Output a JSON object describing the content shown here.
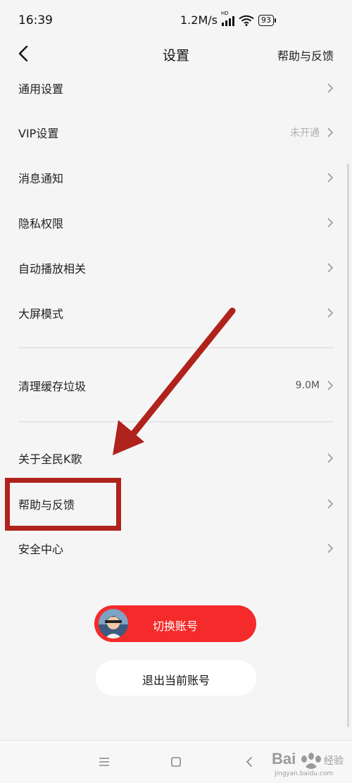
{
  "status_bar": {
    "time": "16:39",
    "net_speed": "1.2M/s",
    "signal_badge": "HD",
    "battery": "93"
  },
  "header": {
    "title": "设置",
    "right_link": "帮助与反馈",
    "back_icon": "back-arrow-icon"
  },
  "settings": {
    "items": [
      {
        "label": "通用设置",
        "value": ""
      },
      {
        "label": "VIP设置",
        "value": "未开通"
      },
      {
        "label": "消息通知",
        "value": ""
      },
      {
        "label": "隐私权限",
        "value": ""
      },
      {
        "label": "自动播放相关",
        "value": ""
      },
      {
        "label": "大屏模式",
        "value": ""
      },
      {
        "label": "清理缓存垃圾",
        "value": "9.0M"
      },
      {
        "label": "关于全民K歌",
        "value": ""
      },
      {
        "label": "帮助与反馈",
        "value": ""
      },
      {
        "label": "安全中心",
        "value": ""
      }
    ]
  },
  "buttons": {
    "switch_account": "切换账号",
    "logout": "退出当前账号"
  },
  "watermark": {
    "brand": "Baidu",
    "site": "jingyan.baidu.com"
  },
  "colors": {
    "accent_red": "#f52a2a",
    "annotation_red": "#b0221c",
    "background": "#f5f5f5"
  }
}
